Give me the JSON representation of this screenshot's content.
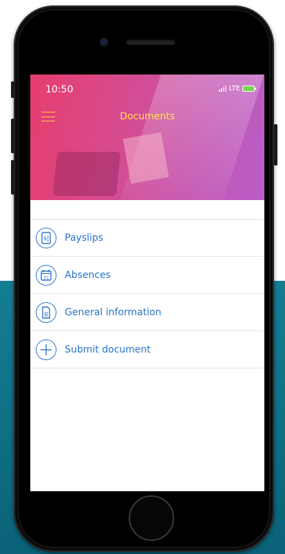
{
  "status_bar": {
    "time": "10:50",
    "network": "LTE"
  },
  "header": {
    "title": "Documents"
  },
  "menu_items": [
    {
      "label": "Payslips",
      "icon": "payslip-icon"
    },
    {
      "label": "Absences",
      "icon": "calendar-icon",
      "calendar_day": "31"
    },
    {
      "label": "General information",
      "icon": "document-icon"
    },
    {
      "label": "Submit document",
      "icon": "plus-icon"
    }
  ],
  "colors": {
    "accent": "#2a73c7",
    "title": "#ffe14a",
    "header_start": "#e63d6e",
    "header_end": "#b95fc8",
    "background_teal": "#157e93"
  }
}
